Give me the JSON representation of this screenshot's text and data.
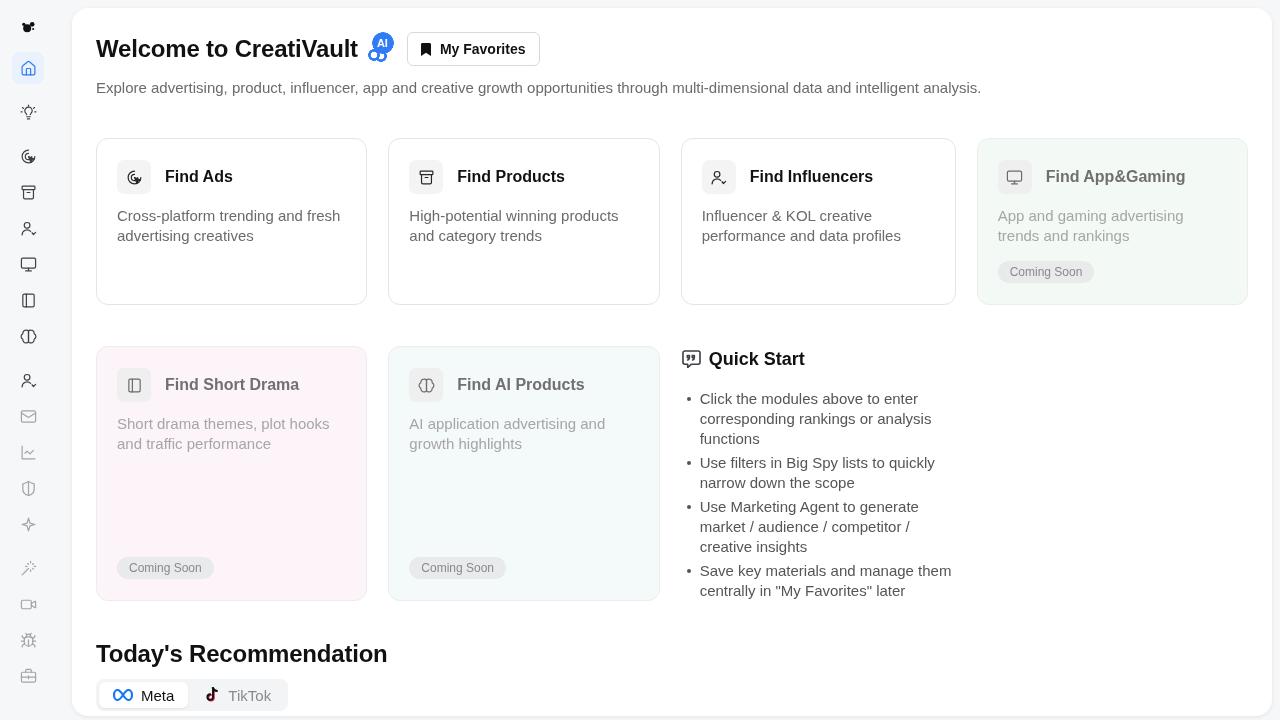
{
  "sidebar": {
    "groups": [
      [
        {
          "selected": true,
          "disabled": false
        }
      ],
      [
        {
          "selected": false,
          "disabled": false
        }
      ],
      [
        {
          "selected": false,
          "disabled": false
        },
        {
          "selected": false,
          "disabled": false
        },
        {
          "selected": false,
          "disabled": false
        },
        {
          "selected": false,
          "disabled": false
        },
        {
          "selected": false,
          "disabled": false
        },
        {
          "selected": false,
          "disabled": false
        }
      ],
      [
        {
          "selected": false,
          "disabled": false
        },
        {
          "selected": false,
          "disabled": true
        },
        {
          "selected": false,
          "disabled": true
        },
        {
          "selected": false,
          "disabled": true
        },
        {
          "selected": false,
          "disabled": true
        }
      ],
      [
        {
          "selected": false,
          "disabled": true
        },
        {
          "selected": false,
          "disabled": true
        },
        {
          "selected": false,
          "disabled": true
        },
        {
          "selected": false,
          "disabled": true
        }
      ]
    ]
  },
  "header": {
    "title": "Welcome to CreatiVault",
    "ai_badge": "AI",
    "favorites_button": "My Favorites",
    "subtitle": "Explore advertising, product, influencer, app and creative growth opportunities through multi-dimensional data and intelligent analysis."
  },
  "cards": [
    {
      "title": "Find Ads",
      "description": "Cross-platform trending and fresh advertising creatives",
      "disabled": false,
      "color": "#ffffff"
    },
    {
      "title": "Find Products",
      "description": "High-potential winning products and category trends",
      "disabled": false,
      "color": "#ffffff"
    },
    {
      "title": "Find Influencers",
      "description": "Influencer & KOL creative performance and data profiles",
      "disabled": false,
      "color": "#ffffff"
    },
    {
      "title": "Find App&Gaming",
      "description": "App and gaming advertising trends and rankings",
      "disabled": true,
      "badge": "Coming Soon",
      "color": "#f3faf6"
    },
    {
      "title": "Find Short Drama",
      "description": "Short drama themes, plot hooks and traffic performance",
      "disabled": true,
      "badge": "Coming Soon",
      "color": "#fdf4f9"
    },
    {
      "title": "Find AI Products",
      "description": "AI application advertising and growth highlights",
      "disabled": true,
      "badge": "Coming Soon",
      "color": "#f4f9f9"
    }
  ],
  "quick_start": {
    "title": "Quick Start",
    "tips": [
      "Click the modules above to enter corresponding rankings or analysis functions",
      "Use filters in Big Spy lists to quickly narrow down the scope",
      "Use Marketing Agent to generate market / audience / competitor / creative insights",
      "Save key materials and manage them centrally in \"My Favorites\" later"
    ]
  },
  "recommendation": {
    "title": "Today's Recommendation",
    "tabs": [
      {
        "label": "Meta",
        "selected": true
      },
      {
        "label": "TikTok",
        "selected": false
      }
    ]
  }
}
